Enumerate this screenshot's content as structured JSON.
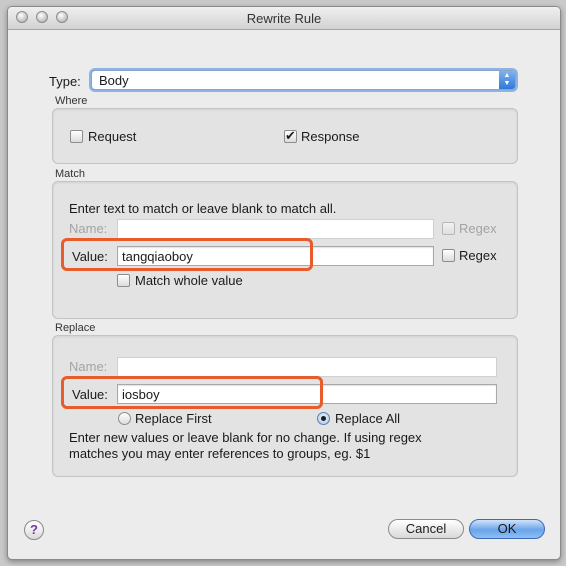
{
  "window": {
    "title": "Rewrite Rule"
  },
  "type": {
    "label": "Type:",
    "value": "Body"
  },
  "where": {
    "heading": "Where",
    "request_label": "Request",
    "request_checked": false,
    "response_label": "Response",
    "response_checked": true
  },
  "match": {
    "heading": "Match",
    "instructions": "Enter text to match or leave blank to match all.",
    "name_label": "Name:",
    "name_value": "",
    "name_regex_label": "Regex",
    "value_label": "Value:",
    "value_value": "tangqiaoboy",
    "value_regex_label": "Regex",
    "whole_value_label": "Match whole value"
  },
  "replace": {
    "heading": "Replace",
    "name_label": "Name:",
    "name_value": "",
    "value_label": "Value:",
    "value_value": "iosboy",
    "first_label": "Replace First",
    "all_label": "Replace All",
    "selected": "Replace All",
    "help_line1": "Enter new values or leave blank for no change. If using regex",
    "help_line2": "matches you may enter references to groups, eg. $1"
  },
  "buttons": {
    "help": "?",
    "cancel": "Cancel",
    "ok": "OK"
  },
  "colors": {
    "highlight": "#e85b2a",
    "default_button": "#6aa4ea"
  }
}
